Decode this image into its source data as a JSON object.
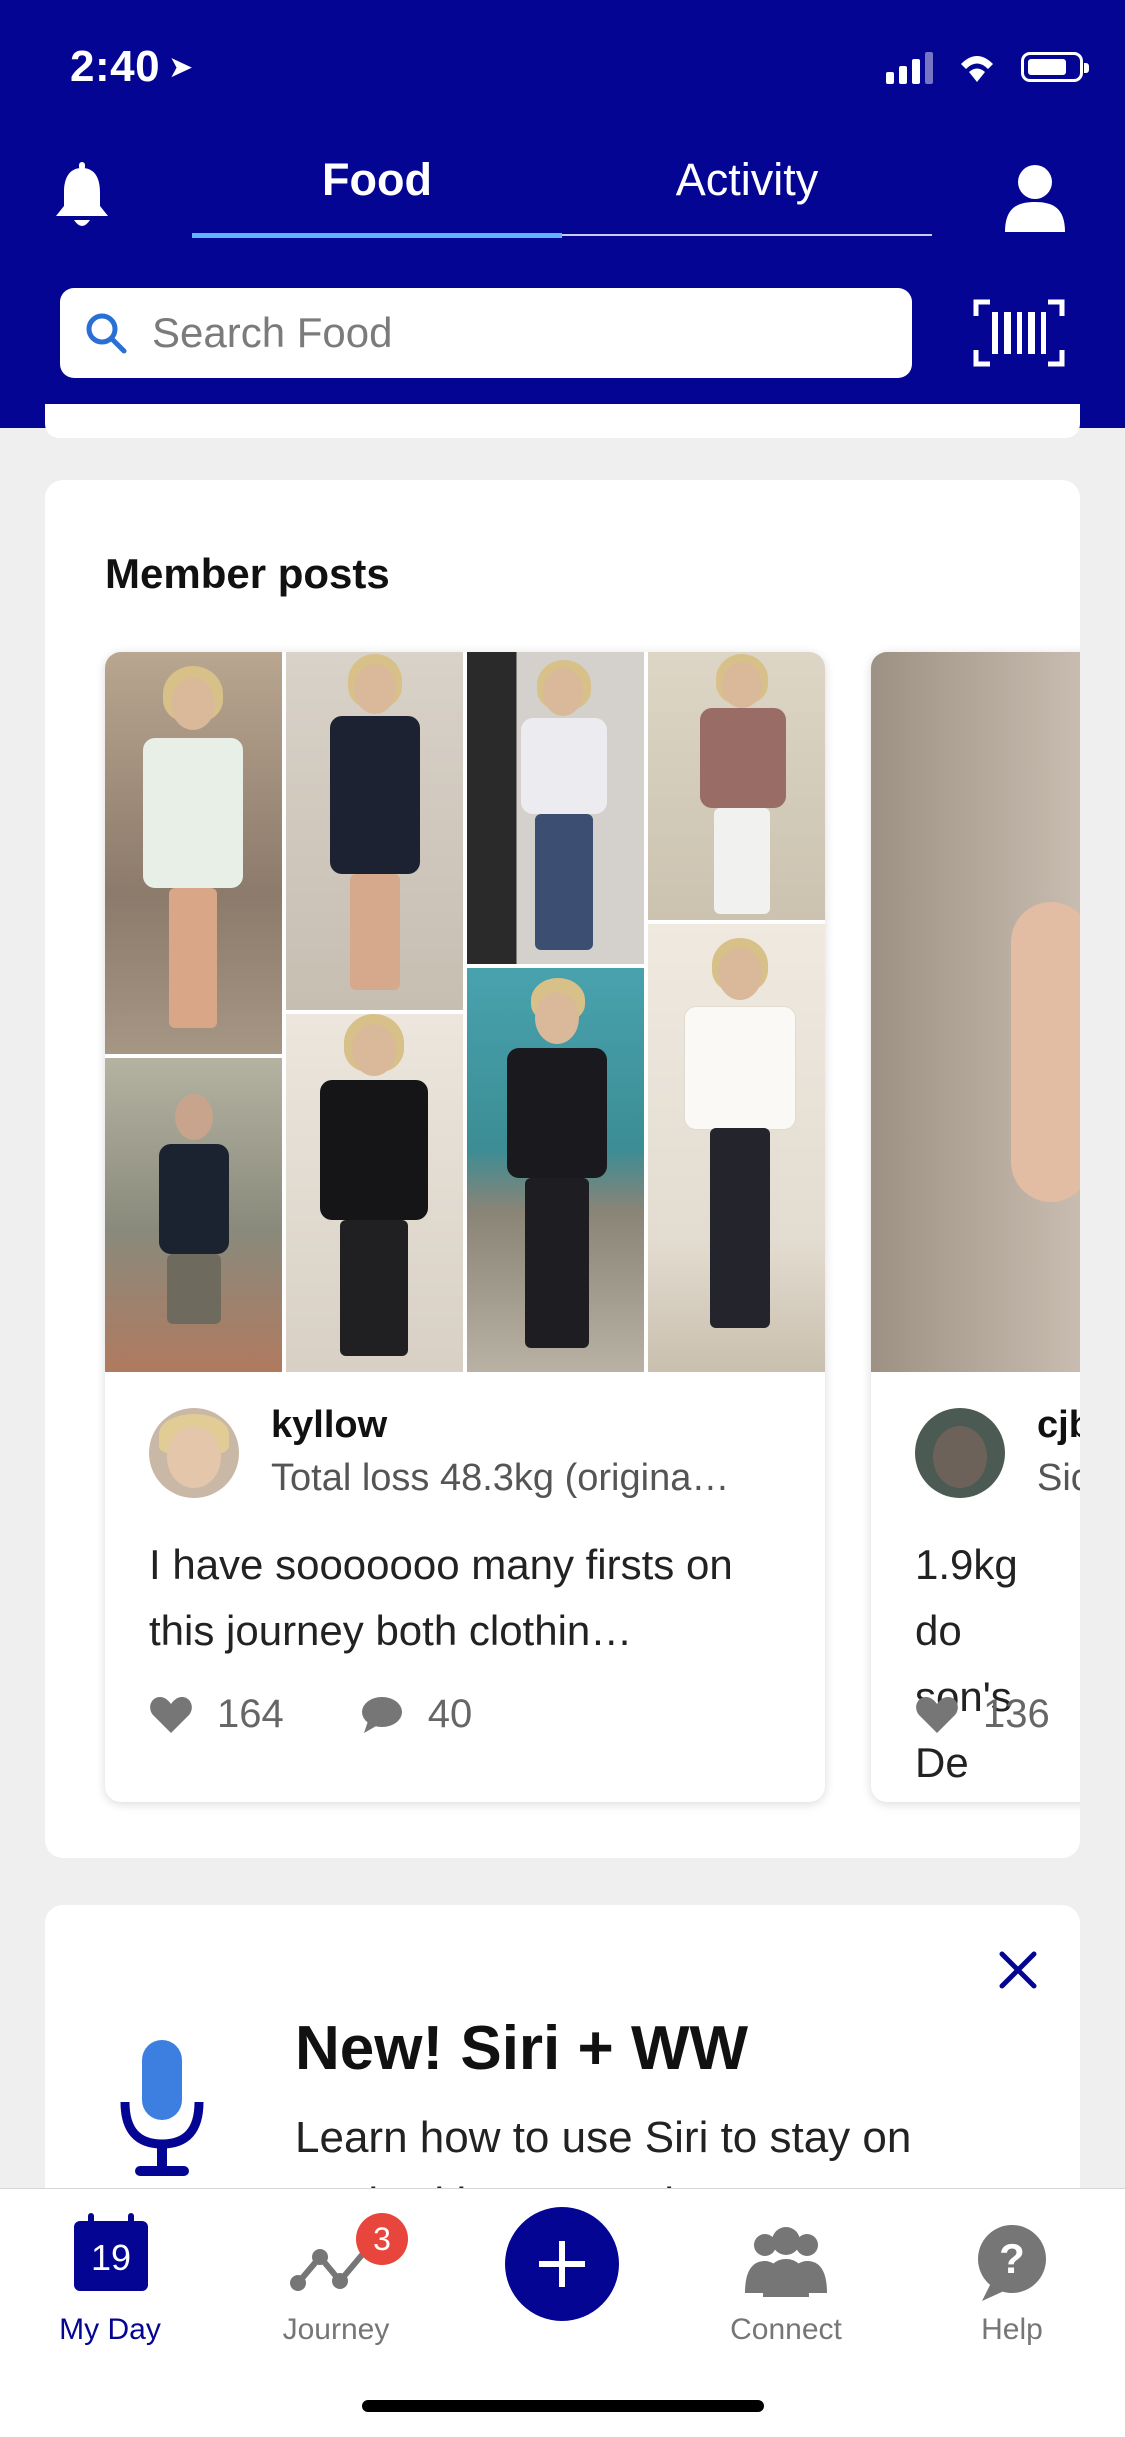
{
  "status_bar": {
    "time": "2:40"
  },
  "header": {
    "tabs": [
      {
        "label": "Food",
        "active": true
      },
      {
        "label": "Activity",
        "active": false
      }
    ],
    "search_placeholder": "Search Food"
  },
  "member_posts": {
    "title": "Member posts",
    "posts": [
      {
        "username": "kyllow",
        "subtitle": "Total loss 48.3kg (origina…",
        "text": "I have sooooooo many firsts on this journey both clothin…",
        "likes": "164",
        "comments": "40"
      },
      {
        "username": "cjb",
        "subtitle": "Sic",
        "text": "1.9kg do son's De",
        "likes": "136"
      }
    ]
  },
  "siri_card": {
    "title": "New! Siri + WW",
    "body": "Learn how to use Siri to stay on track with your goals"
  },
  "tab_bar": {
    "items": [
      {
        "label": "My Day",
        "date": "19",
        "active": true
      },
      {
        "label": "Journey",
        "badge": "3"
      },
      {
        "label": "Connect"
      },
      {
        "label": "Help"
      }
    ]
  },
  "colors": {
    "brand": "#050594",
    "accent": "#5fb5ff",
    "badge": "#e8453c"
  }
}
